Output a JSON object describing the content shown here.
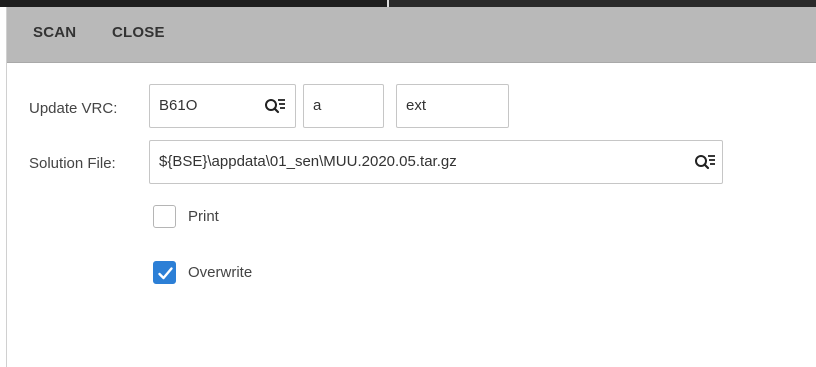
{
  "menubar": {
    "scan_label": "SCAN",
    "close_label": "CLOSE"
  },
  "form": {
    "update_vrc": {
      "label": "Update VRC:",
      "value": "B61O",
      "field2": "a",
      "field3": "ext"
    },
    "solution_file": {
      "label": "Solution File:",
      "value": "${BSE}\\appdata\\01_sen\\MUU.2020.05.tar.gz"
    },
    "print": {
      "label": "Print",
      "checked": false
    },
    "overwrite": {
      "label": "Overwrite",
      "checked": true
    }
  },
  "icons": {
    "lookup": "search-list-icon",
    "check": "checkmark-icon"
  },
  "colors": {
    "menubar_bg": "#b9b9b9",
    "checkbox_checked": "#2c7fd6"
  }
}
